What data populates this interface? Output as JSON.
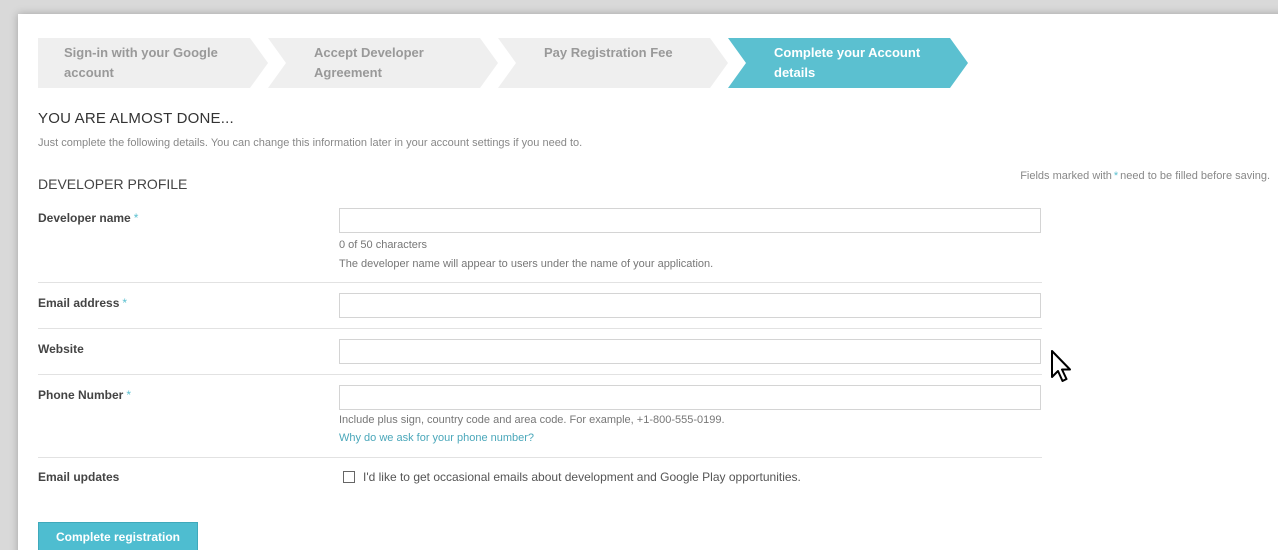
{
  "steps": [
    {
      "label": "Sign-in with your Google account",
      "active": false
    },
    {
      "label": "Accept Developer Agreement",
      "active": false
    },
    {
      "label": "Pay Registration Fee",
      "active": false
    },
    {
      "label": "Complete your Account details",
      "active": true
    }
  ],
  "page": {
    "title": "YOU ARE ALMOST DONE...",
    "subtitle": "Just complete the following details. You can change this information later in your account settings if you need to."
  },
  "profile": {
    "section_title": "DEVELOPER PROFILE",
    "required_note_prefix": "Fields marked with",
    "required_star": "*",
    "required_note_suffix": "need to be filled before saving."
  },
  "fields": {
    "developer_name": {
      "label": "Developer name",
      "required": "*",
      "value": "",
      "counter": "0 of 50 characters",
      "hint": "The developer name will appear to users under the name of your application."
    },
    "email": {
      "label": "Email address",
      "required": "*",
      "value": ""
    },
    "website": {
      "label": "Website",
      "value": ""
    },
    "phone": {
      "label": "Phone Number",
      "required": "*",
      "value": "",
      "hint": "Include plus sign, country code and area code. For example, +1-800-555-0199.",
      "link": "Why do we ask for your phone number?"
    },
    "email_updates": {
      "label": "Email updates",
      "checkbox_label": "I'd like to get occasional emails about development and Google Play opportunities.",
      "checked": false
    }
  },
  "actions": {
    "submit_label": "Complete registration"
  },
  "colors": {
    "accent": "#5bc0d0",
    "step_inactive": "#efefef",
    "link": "#4aa7ba"
  },
  "icons": {
    "cursor": "mouse-pointer-icon"
  }
}
